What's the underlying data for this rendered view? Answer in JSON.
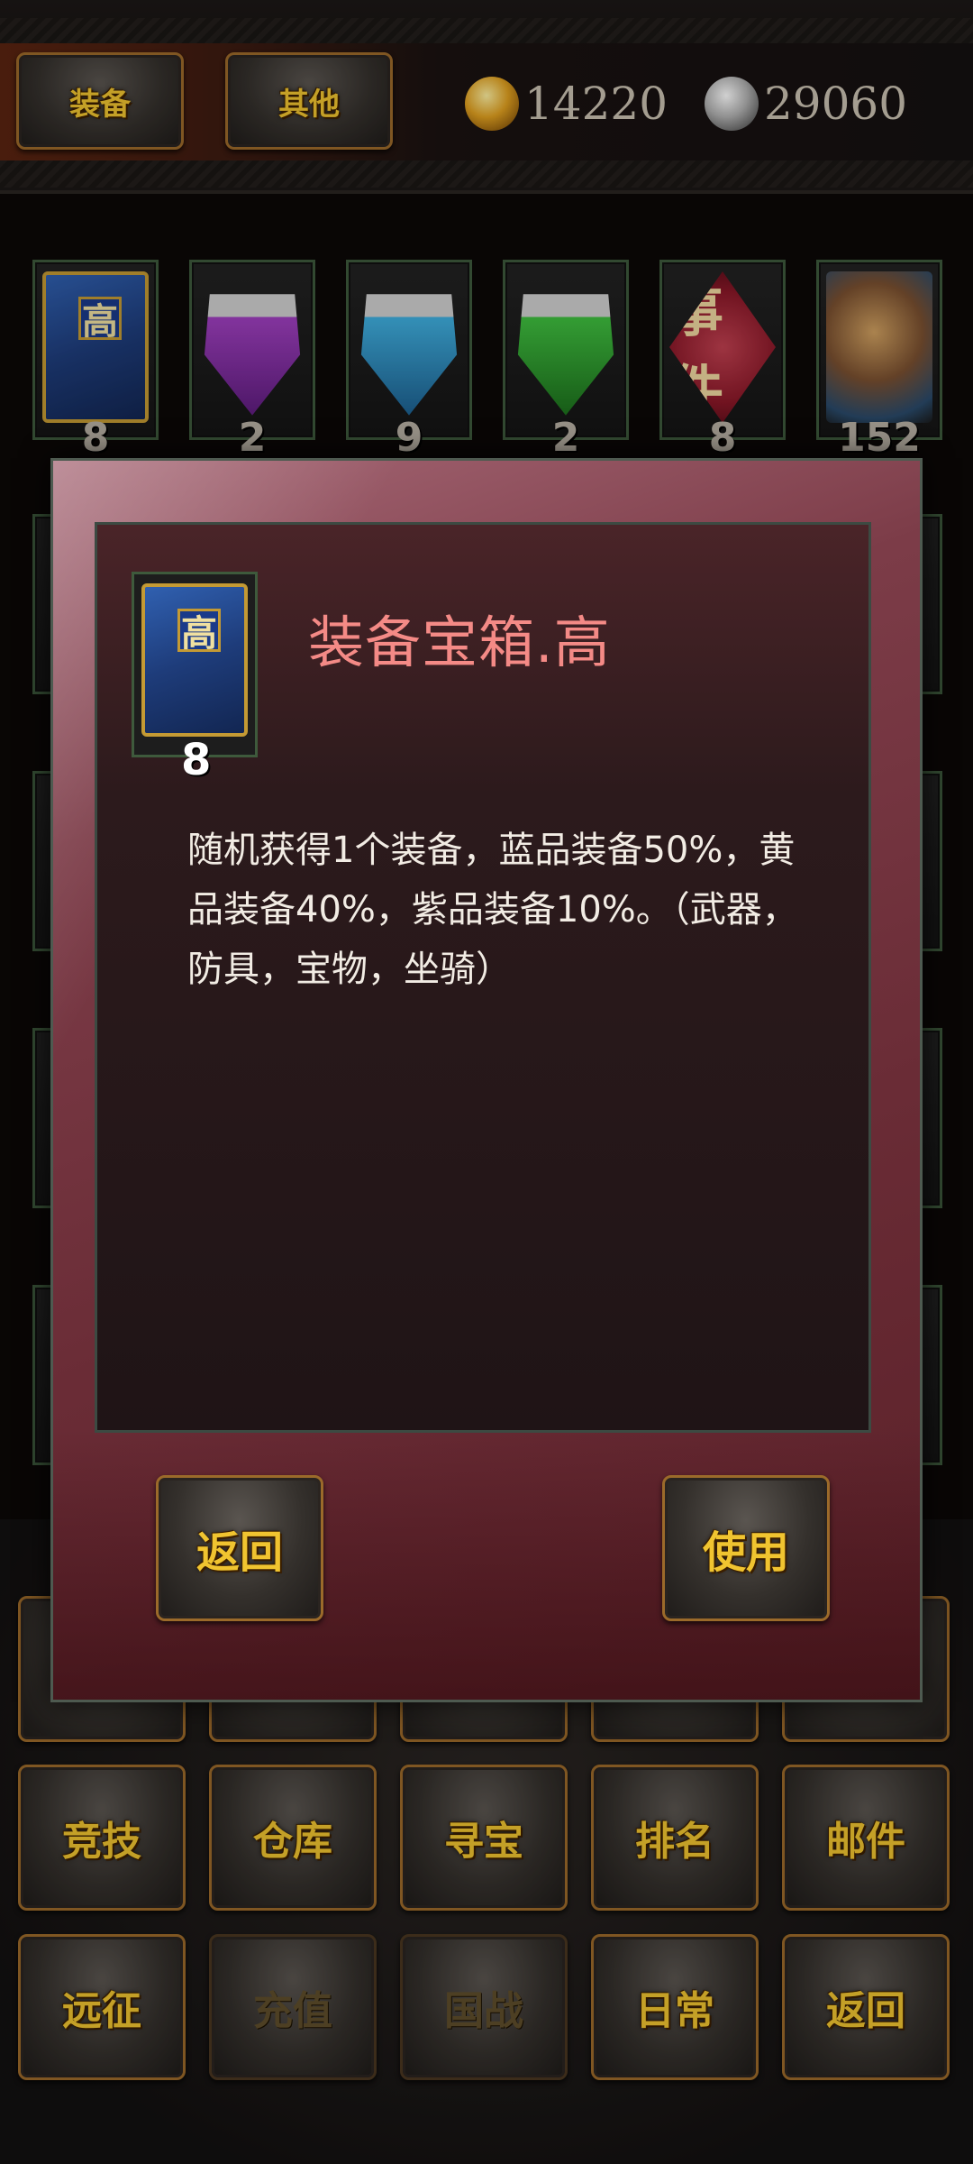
{
  "tabs": {
    "equip": "装备",
    "other": "其他"
  },
  "currency": {
    "gold": "14220",
    "silver": "29060"
  },
  "inventory_top_row": [
    {
      "icon": "treasure-box-icon",
      "count": "8",
      "glyph": "高"
    },
    {
      "icon": "purple-gem-chest-icon",
      "count": "2"
    },
    {
      "icon": "cyan-gem-chest-icon",
      "count": "9"
    },
    {
      "icon": "green-gem-chest-icon",
      "count": "2"
    },
    {
      "icon": "event-token-icon",
      "count": "8",
      "glyph": "事件"
    },
    {
      "icon": "hammer-icon",
      "count": "152"
    }
  ],
  "bottom_menu": {
    "row2": [
      "竞技",
      "仓库",
      "寻宝",
      "排名",
      "邮件"
    ],
    "row3": [
      "远征",
      "充值",
      "国战",
      "日常",
      "返回"
    ]
  },
  "dialog": {
    "title": "装备宝箱.高",
    "count": "8",
    "icon_glyph": "高",
    "description": "随机获得1个装备，蓝品装备50%，黄品装备40%，紫品装备10%。（武器，防具，宝物，坐骑）",
    "back_label": "返回",
    "use_label": "使用"
  }
}
